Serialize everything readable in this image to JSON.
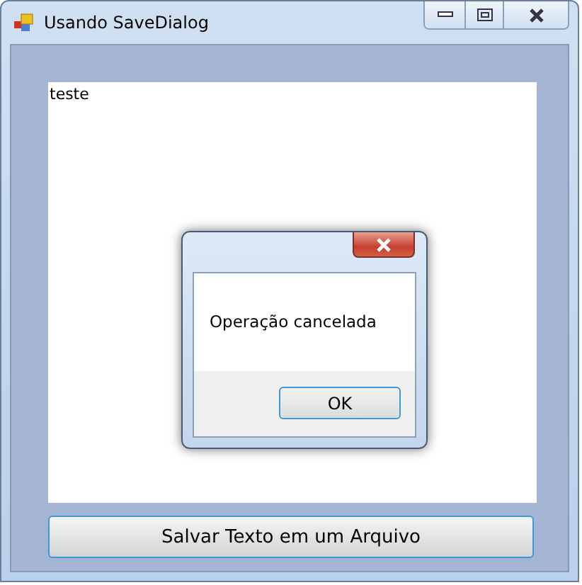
{
  "window": {
    "title": "Usando SaveDialog"
  },
  "text_box": {
    "value": "teste"
  },
  "save_button": {
    "label": "Salvar Texto em um Arquivo"
  },
  "message_box": {
    "message": "Operação cancelada",
    "button": "OK"
  }
}
